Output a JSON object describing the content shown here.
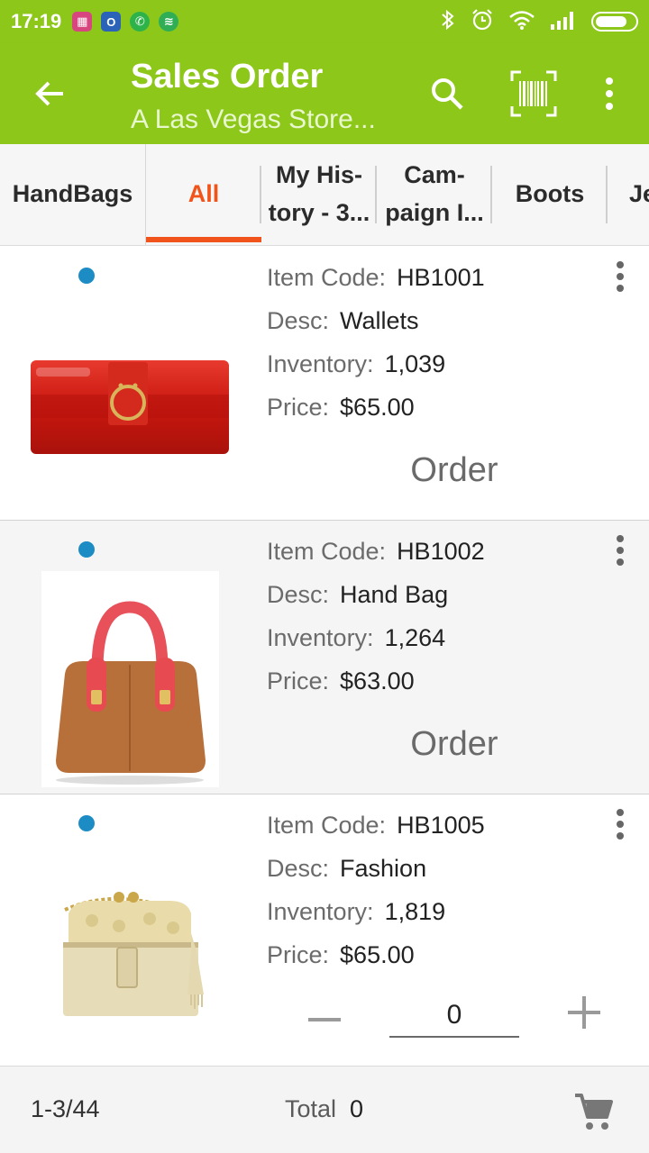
{
  "status_bar": {
    "time": "17:19",
    "notification_icons": [
      "calendar-app-icon",
      "outlook-app-icon",
      "whatsapp-app-icon",
      "spotify-app-icon"
    ],
    "system_icons": [
      "bluetooth-icon",
      "alarm-icon",
      "wifi-icon",
      "signal-icon",
      "battery-icon"
    ],
    "battery_level": 0.8
  },
  "app_bar": {
    "title": "Sales Order",
    "subtitle": "A Las Vegas Store...",
    "accent_color": "#8dc71a"
  },
  "tabs": [
    {
      "label": "HandBags",
      "active": false
    },
    {
      "label": "All",
      "active": true
    },
    {
      "label": "My His- tory - 3...",
      "line1": "My His-",
      "line2": "tory - 3...",
      "active": false
    },
    {
      "label": "Cam- paign I...",
      "line1": "Cam-",
      "line2": "paign I...",
      "active": false
    },
    {
      "label": "Boots",
      "active": false
    },
    {
      "label": "Je",
      "active": false
    }
  ],
  "tab_active_color": "#f1541b",
  "labels": {
    "item_code": "Item Code:",
    "desc": "Desc:",
    "inventory": "Inventory:",
    "price": "Price:",
    "order": "Order"
  },
  "items": [
    {
      "item_code": "HB1001",
      "desc": "Wallets",
      "inventory": "1,039",
      "price": "$65.00",
      "image": "red-wallet",
      "action": "order"
    },
    {
      "item_code": "HB1002",
      "desc": "Hand Bag",
      "inventory": "1,264",
      "price": "$63.00",
      "image": "brown-handbag",
      "action": "order"
    },
    {
      "item_code": "HB1005",
      "desc": "Fashion",
      "inventory": "1,819",
      "price": "$65.00",
      "image": "gold-purse",
      "action": "quantity",
      "quantity": "0"
    }
  ],
  "footer": {
    "paging": "1-3/44",
    "total_label": "Total",
    "total_value": "0"
  }
}
